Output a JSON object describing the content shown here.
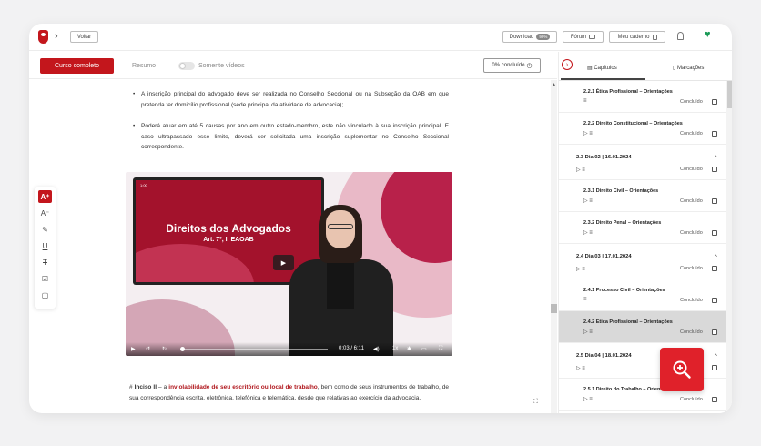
{
  "topbar": {
    "back_label": "Voltar",
    "download_label": "Download",
    "download_badge": "99%",
    "forum_label": "Fórum",
    "notebook_label": "Meu caderno"
  },
  "tabs": {
    "complete_course": "Curso completo",
    "summary": "Resumo",
    "videos_only": "Somente vídeos",
    "progress": "0% concluído"
  },
  "content": {
    "bullet1": "A inscrição principal do advogado deve ser realizada no Conselho Seccional ou na Subseção da OAB em que pretenda ter domicílio profissional (sede principal da atividade de advocacia);",
    "bullet2": "Poderá atuar em até 5 causas por ano em outro estado-membro, este não vinculado à sua inscrição principal. E caso ultrapassado esse limite, deverá ser solicitada uma inscrição suplementar no Conselho Seccional correspondente.",
    "para_prefix": "# ",
    "para_bold": "Inciso II",
    "para_dash": " – a ",
    "para_highlight": "inviolabilidade de seu escritório ou local de trabalho",
    "para_rest": ", bem como de seus instrumentos de trabalho, de sua correspondência escrita, eletrônica, telefônica e telemática, desde que relativas ao exercício da advocacia."
  },
  "video": {
    "title": "Direitos dos Advogados",
    "subtitle": "Art. 7º, I, EAOAB",
    "time": "0:03 / 6:11",
    "speed": "1x",
    "corner_label": "1:00"
  },
  "sidebar": {
    "tab_chapters": "Capítulos",
    "tab_bookmarks": "Marcações",
    "done_label": "Concluído",
    "items": [
      {
        "type": "lesson",
        "title": "2.2.1 Ética Profissional – Orientações",
        "icons": "≡"
      },
      {
        "type": "lesson",
        "title": "2.2.2 Direito Constitucional – Orientações",
        "icons": "▷ ≡"
      },
      {
        "type": "day",
        "title": "2.3 Dia 02 | 16.01.2024",
        "icons": "▷ ≡"
      },
      {
        "type": "lesson",
        "title": "2.3.1 Direito Civil – Orientações",
        "icons": "▷ ≡"
      },
      {
        "type": "lesson",
        "title": "2.3.2 Direito Penal – Orientações",
        "icons": "▷ ≡"
      },
      {
        "type": "day",
        "title": "2.4 Dia 03 | 17.01.2024",
        "icons": "▷ ≡"
      },
      {
        "type": "lesson",
        "title": "2.4.1 Processo Civil – Orientações",
        "icons": "≡"
      },
      {
        "type": "lesson",
        "title": "2.4.2 Ética Profissional – Orientações",
        "icons": "▷ ≡",
        "selected": true
      },
      {
        "type": "day",
        "title": "2.5 Dia 04 | 18.01.2024",
        "icons": "▷ ≡"
      },
      {
        "type": "lesson",
        "title": "2.5.1 Direito do Trabalho – Orientações",
        "icons": "▷ ≡"
      }
    ]
  },
  "colors": {
    "brand_red": "#c3161c",
    "fab_red": "#e0212a",
    "heart_green": "#1b9a57"
  }
}
